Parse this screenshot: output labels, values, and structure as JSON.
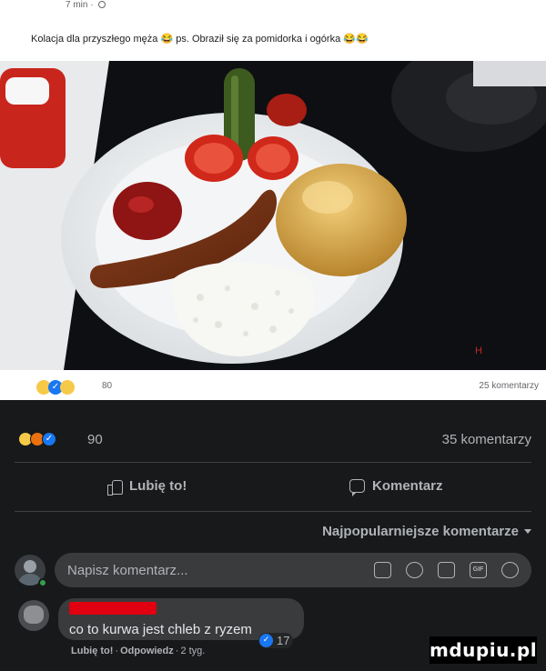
{
  "inner_post": {
    "time": "7 min",
    "caption": "Kolacja dla przyszłego męża",
    "caption_emoji_1": "😂",
    "caption_part2": "ps. Obraził się za pomidorka i ogórka",
    "caption_emoji_2": "😂😂",
    "reaction_count": "80",
    "comment_count": "25 komentarzy"
  },
  "post_stats": {
    "reaction_count": "90",
    "comment_count": "35 komentarzy",
    "reactions": [
      "haha",
      "angry",
      "like"
    ]
  },
  "actions": {
    "like_label": "Lubię to!",
    "comment_label": "Komentarz"
  },
  "sort": {
    "label": "Najpopularniejsze komentarze"
  },
  "compose": {
    "placeholder": "Napisz komentarz..."
  },
  "comment": {
    "text": "co to kurwa jest chleb z ryzem",
    "like_link": "Lubię to!",
    "reply_link": "Odpowiedz",
    "age": "2 tyg.",
    "like_count": "17"
  },
  "watermark": {
    "text": "mdupiu.pl"
  },
  "colors": {
    "background": "#18191a",
    "input_bg": "#3a3b3c",
    "secondary_text": "#b0b3b8",
    "like_blue": "#1877f2",
    "online_green": "#31a24c",
    "redaction_red": "#e0000f"
  }
}
